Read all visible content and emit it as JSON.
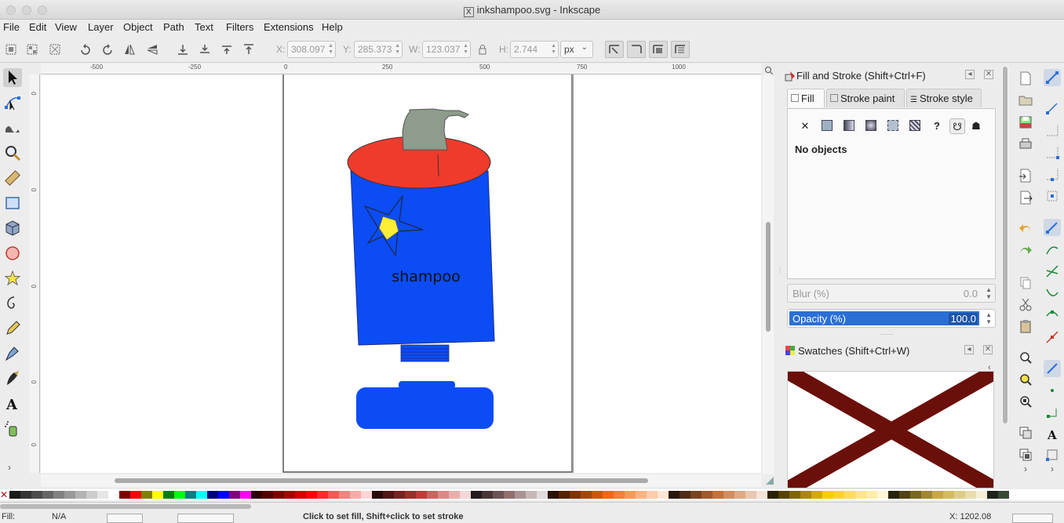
{
  "window": {
    "title": "inkshampoo.svg - Inkscape"
  },
  "menu": [
    "File",
    "Edit",
    "View",
    "Layer",
    "Object",
    "Path",
    "Text",
    "Filters",
    "Extensions",
    "Help"
  ],
  "toolbar": {
    "x_label": "X:",
    "x_value": "308.097",
    "y_label": "Y:",
    "y_value": "285.373",
    "w_label": "W:",
    "w_value": "123.037",
    "h_label": "H:",
    "h_value": "2.744",
    "unit": "px"
  },
  "ruler_top": [
    "-500",
    "-250",
    "0",
    "250",
    "500",
    "750",
    "1000"
  ],
  "ruler_left": [
    "0",
    "0",
    "0",
    "0",
    "0",
    "0"
  ],
  "canvas": {
    "bottle_label": "shampoo",
    "colors": {
      "cap": "#ef3b2c",
      "body": "#0b4cf5",
      "pump": "#8d9c8b",
      "star": "#ffee33",
      "page_border": "#555555"
    }
  },
  "fill_stroke": {
    "title": "Fill and Stroke (Shift+Ctrl+F)",
    "tabs": [
      "Fill",
      "Stroke paint",
      "Stroke style"
    ],
    "active_tab": "Fill",
    "paint_icons": [
      "none-icon",
      "flat-color-icon",
      "linear-gradient-icon",
      "radial-gradient-icon",
      "mesh-gradient-icon",
      "pattern-icon",
      "swatch-icon",
      "unset-icon",
      "fill-rule-evenodd-icon",
      "fill-rule-nonzero-icon"
    ],
    "message": "No objects",
    "blur_label": "Blur (%)",
    "blur_value": "0.0",
    "opacity_label": "Opacity (%)",
    "opacity_value": "100.0"
  },
  "swatches": {
    "title": "Swatches (Shift+Ctrl+W)"
  },
  "status": {
    "fill_label": "Fill:",
    "fill_value": "N/A",
    "message": "Click to set fill, Shift+click to set stroke",
    "cursor": "X: 1202.08"
  },
  "palette": [
    "#1a1a1a",
    "#333333",
    "#4d4d4d",
    "#666666",
    "#808080",
    "#999999",
    "#b3b3b3",
    "#cccccc",
    "#e6e6e6",
    "#ffffff",
    "#800000",
    "#ff0000",
    "#808000",
    "#ffff00",
    "#008000",
    "#00ff00",
    "#008080",
    "#00ffff",
    "#000080",
    "#0000ff",
    "#800080",
    "#ff00ff",
    "#2b0000",
    "#550000",
    "#800000",
    "#aa0000",
    "#d40000",
    "#ff0000",
    "#ff2a2a",
    "#ff5555",
    "#ff8080",
    "#ffaaaa",
    "#ffd5d5",
    "#280b0b",
    "#501616",
    "#782121",
    "#a02c2c",
    "#c83737",
    "#d35f5f",
    "#de8787",
    "#e9afaf",
    "#f4d7d7",
    "#241c1c",
    "#483737",
    "#6c5353",
    "#916f6f",
    "#ac9393",
    "#c8b7b7",
    "#e3dbdb",
    "#2b1100",
    "#552200",
    "#803300",
    "#aa4400",
    "#d45500",
    "#ff6600",
    "#ff7f2a",
    "#ff9955",
    "#ffb380",
    "#ffccaa",
    "#ffe6d5",
    "#28170b",
    "#502d16",
    "#784421",
    "#a05a2c",
    "#c87137",
    "#d38d5f",
    "#deaa87",
    "#e9c6af",
    "#f4e3d7",
    "#2b2200",
    "#554400",
    "#806600",
    "#aa8800",
    "#d4aa00",
    "#ffcc00",
    "#ffd42a",
    "#ffdd55",
    "#ffe680",
    "#ffeeaa",
    "#fff6d5",
    "#28220b",
    "#504416",
    "#786721",
    "#a0892c",
    "#c8ab37",
    "#d3bc5f",
    "#decd87",
    "#e9ddaf",
    "#f4eed7",
    "#1c241c",
    "#374837"
  ]
}
